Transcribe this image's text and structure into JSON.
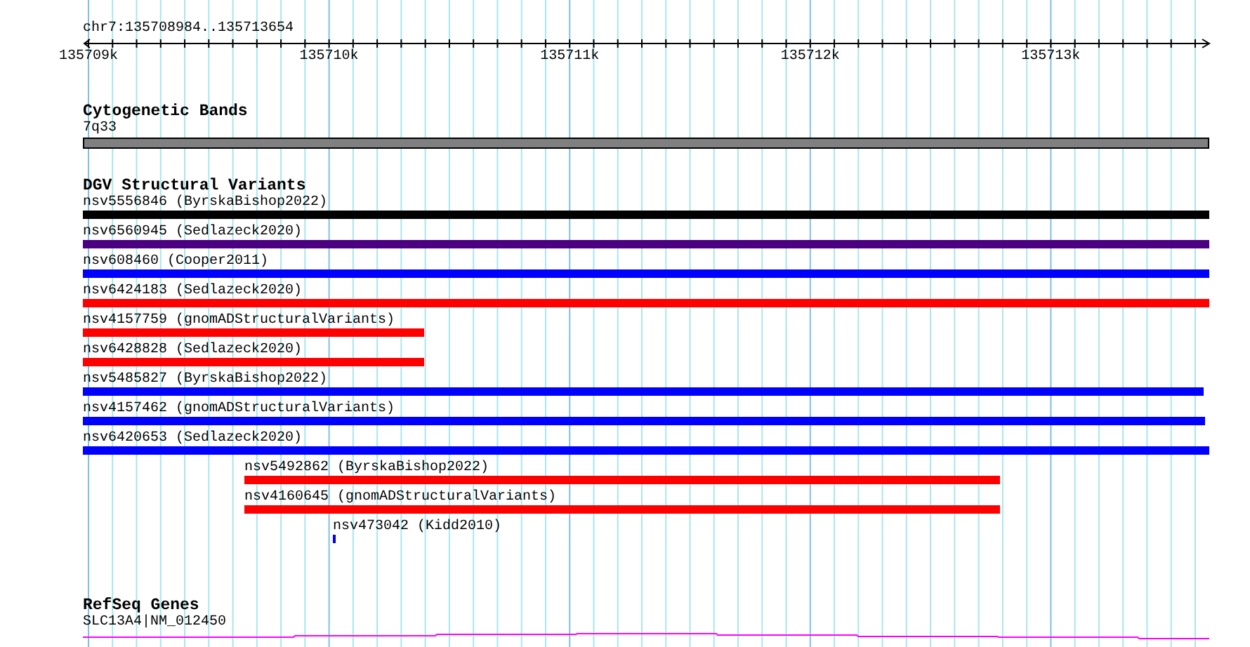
{
  "ruler": {
    "location": "chr7:135708984..135713654",
    "ticks": [
      "135709k",
      "135710k",
      "135711k",
      "135712k",
      "135713k"
    ]
  },
  "tracks": [
    {
      "kind": "cytoband",
      "title": "Cytogenetic Bands",
      "features": [
        {
          "label": "7q33"
        }
      ]
    },
    {
      "kind": "variants",
      "title": "DGV Structural Variants",
      "features": [
        {
          "label": "nsv5556846 (ByrskaBishop2022)",
          "color": "#000000"
        },
        {
          "label": "nsv6560945 (Sedlazeck2020)",
          "color": "#4b0082"
        },
        {
          "label": "nsv608460 (Cooper2011)",
          "color": "#0000ff"
        },
        {
          "label": "nsv6424183 (Sedlazeck2020)",
          "color": "#ff0000"
        },
        {
          "label": "nsv4157759 (gnomADStructuralVariants)",
          "color": "#ff0000"
        },
        {
          "label": "nsv6428828 (Sedlazeck2020)",
          "color": "#ff0000"
        },
        {
          "label": "nsv5485827 (ByrskaBishop2022)",
          "color": "#0000ff"
        },
        {
          "label": "nsv4157462 (gnomADStructuralVariants)",
          "color": "#0000ff"
        },
        {
          "label": "nsv6420653 (Sedlazeck2020)",
          "color": "#0000ff"
        },
        {
          "label": "nsv5492862 (ByrskaBishop2022)",
          "color": "#ff0000"
        },
        {
          "label": "nsv4160645 (gnomADStructuralVariants)",
          "color": "#ff0000"
        },
        {
          "label": "nsv473042 (Kidd2010)",
          "color": "#0000ff"
        }
      ]
    },
    {
      "kind": "gene",
      "title": "RefSeq Genes",
      "features": [
        {
          "label": "SLC13A4|NM_012450"
        }
      ]
    }
  ]
}
